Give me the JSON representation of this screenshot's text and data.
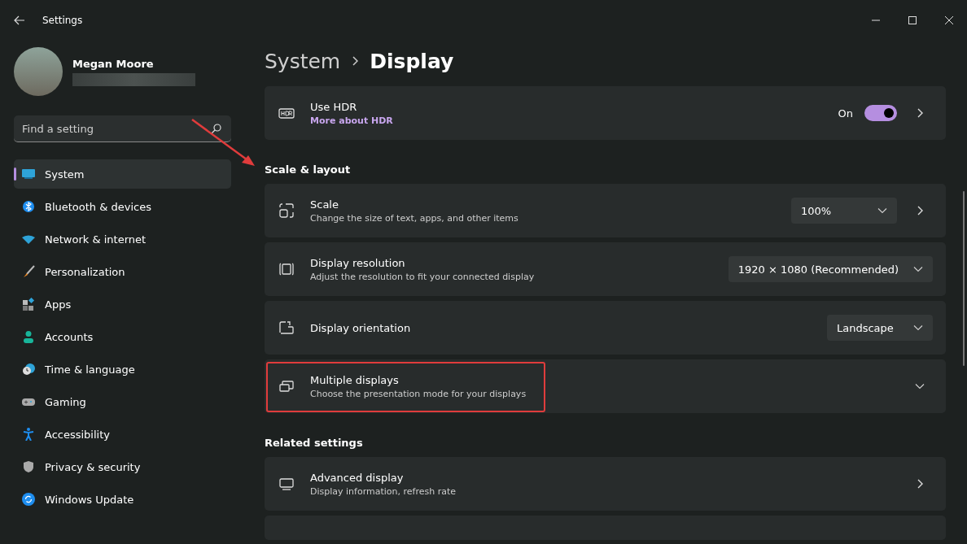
{
  "window": {
    "title": "Settings"
  },
  "profile": {
    "name": "Megan Moore"
  },
  "search": {
    "placeholder": "Find a setting"
  },
  "nav": [
    {
      "label": "System",
      "selected": true
    },
    {
      "label": "Bluetooth & devices",
      "selected": false
    },
    {
      "label": "Network & internet",
      "selected": false
    },
    {
      "label": "Personalization",
      "selected": false
    },
    {
      "label": "Apps",
      "selected": false
    },
    {
      "label": "Accounts",
      "selected": false
    },
    {
      "label": "Time & language",
      "selected": false
    },
    {
      "label": "Gaming",
      "selected": false
    },
    {
      "label": "Accessibility",
      "selected": false
    },
    {
      "label": "Privacy & security",
      "selected": false
    },
    {
      "label": "Windows Update",
      "selected": false
    }
  ],
  "breadcrumb": {
    "parent": "System",
    "current": "Display"
  },
  "sections": [
    {
      "rows": [
        {
          "kind": "toggle",
          "title": "Use HDR",
          "link": "More about HDR",
          "state_label": "On",
          "on": true,
          "highlighted": false
        }
      ]
    },
    {
      "heading": "Scale & layout",
      "rows": [
        {
          "kind": "dropdown",
          "title": "Scale",
          "subtitle": "Change the size of text, apps, and other items",
          "value": "100%",
          "chevron": true,
          "highlighted": false
        },
        {
          "kind": "dropdown",
          "title": "Display resolution",
          "subtitle": "Adjust the resolution to fit your connected display",
          "value": "1920 × 1080 (Recommended)",
          "chevron": false,
          "highlighted": false
        },
        {
          "kind": "dropdown",
          "title": "Display orientation",
          "value": "Landscape",
          "chevron": false,
          "highlighted": false
        },
        {
          "kind": "expand",
          "title": "Multiple displays",
          "subtitle": "Choose the presentation mode for your displays",
          "expanded": false,
          "highlighted": true
        }
      ]
    },
    {
      "heading": "Related settings",
      "rows": [
        {
          "kind": "link",
          "title": "Advanced display",
          "subtitle": "Display information, refresh rate",
          "highlighted": false
        }
      ]
    }
  ]
}
